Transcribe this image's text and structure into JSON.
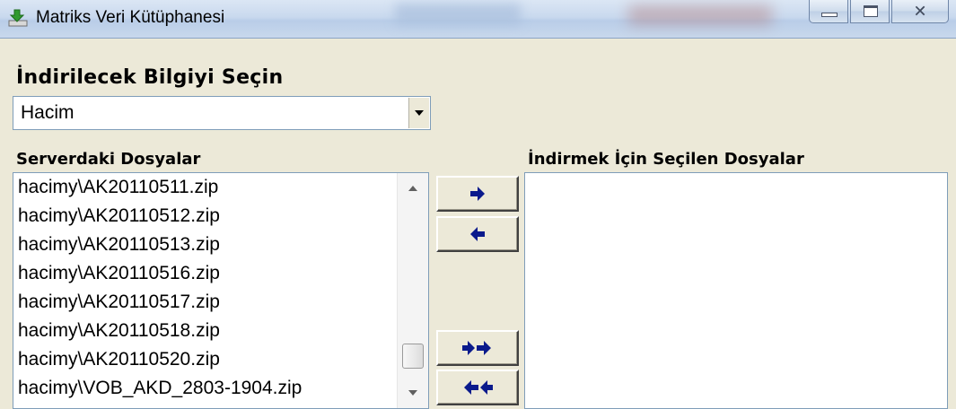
{
  "window": {
    "title": "Matriks Veri Kütüphanesi",
    "icon": "download-icon"
  },
  "form": {
    "heading": "İndirilecek Bilgiyi Seçin",
    "combo_value": "Hacim",
    "server_files_label": "Serverdaki Dosyalar",
    "selected_files_label": "İndirmek İçin Seçilen Dosyalar"
  },
  "server_files": [
    "hacimy\\AK20110511.zip",
    "hacimy\\AK20110512.zip",
    "hacimy\\AK20110513.zip",
    "hacimy\\AK20110516.zip",
    "hacimy\\AK20110517.zip",
    "hacimy\\AK20110518.zip",
    "hacimy\\AK20110520.zip",
    "hacimy\\VOB_AKD_2803-1904.zip"
  ],
  "selected_files": [],
  "buttons": {
    "add_one": "arrow-right-icon",
    "remove_one": "arrow-left-icon",
    "add_all": "double-arrow-right-icon",
    "remove_all": "double-arrow-left-icon"
  },
  "colors": {
    "arrow": "#0a1a8c",
    "face": "#ece9d8"
  }
}
